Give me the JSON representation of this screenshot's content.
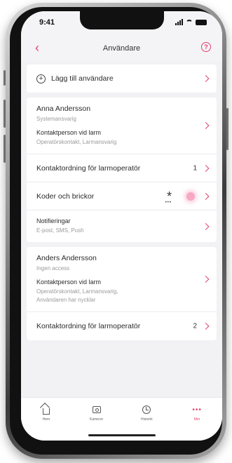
{
  "status_bar": {
    "time": "9:41"
  },
  "header": {
    "title": "Användare",
    "back_icon": "chevron-left-icon",
    "help_icon": "question-circle-icon"
  },
  "add_user": {
    "label": "Lägg till användare",
    "icon": "plus-circle-icon"
  },
  "users": [
    {
      "name": "Anna Andersson",
      "role": "Systemansvarig",
      "contact_title": "Kontaktperson vid larm",
      "contact_detail": "Operatörskontakt, Larmansvarig",
      "contact_order_label": "Kontaktordning för larmoperatör",
      "contact_order_value": "1",
      "codes_label": "Koder och brickor",
      "notifications_label": "Notifieringar",
      "notifications_detail": "E-post, SMS, Push"
    },
    {
      "name": "Anders Andersson",
      "role": "Ingen access",
      "contact_title": "Kontaktperson vid larm",
      "contact_detail_line1": "Operatörskontakt, Larmansvarig,",
      "contact_detail_line2": "Användaren har nycklar",
      "contact_order_label": "Kontaktordning för larmoperatör",
      "contact_order_value": "2"
    }
  ],
  "codes_icon": "asterisk-icon",
  "tabbar": {
    "items": [
      {
        "label": "Hem",
        "icon": "home-icon"
      },
      {
        "label": "Kameror",
        "icon": "camera-icon"
      },
      {
        "label": "Historik",
        "icon": "clock-icon"
      },
      {
        "label": "Mer",
        "icon": "more-icon"
      }
    ],
    "active_index": 3
  },
  "colors": {
    "accent": "#e2426d",
    "background": "#f2f1f3",
    "card": "#ffffff"
  }
}
